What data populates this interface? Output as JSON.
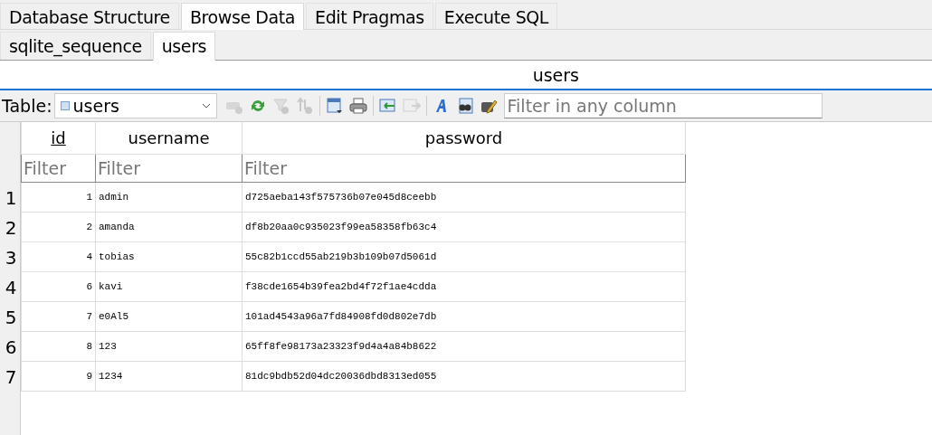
{
  "tabs": [
    {
      "label": "Database Structure",
      "selected": false
    },
    {
      "label": "Browse Data",
      "selected": true
    },
    {
      "label": "Edit Pragmas",
      "selected": false
    },
    {
      "label": "Execute SQL",
      "selected": false
    }
  ],
  "table_tabs": [
    {
      "label": "sqlite_sequence",
      "selected": false
    },
    {
      "label": "users",
      "selected": true
    }
  ],
  "view_title": "users",
  "toolbar": {
    "table_label": "Table:",
    "table_value": "users",
    "button_groups": [
      [
        {
          "kind": "new-record",
          "disabled": true
        },
        {
          "kind": "refresh",
          "disabled": false
        },
        {
          "kind": "clear-filters",
          "disabled": true
        },
        {
          "kind": "clear-sort",
          "disabled": true
        }
      ],
      [
        {
          "kind": "save",
          "disabled": false
        },
        {
          "kind": "print",
          "disabled": false
        }
      ],
      [
        {
          "kind": "insert",
          "disabled": false
        },
        {
          "kind": "export",
          "disabled": true
        }
      ],
      [
        {
          "kind": "font",
          "disabled": false
        },
        {
          "kind": "find",
          "disabled": false
        },
        {
          "kind": "edit",
          "disabled": false
        }
      ]
    ],
    "filter_placeholder": "Filter in any column"
  },
  "table": {
    "columns": [
      {
        "label": "id",
        "key": true
      },
      {
        "label": "username",
        "key": false
      },
      {
        "label": "password",
        "key": false
      }
    ],
    "filters": [
      {
        "placeholder": "Filter"
      },
      {
        "placeholder": "Filter"
      },
      {
        "placeholder": "Filter"
      }
    ],
    "rows": [
      {
        "num": "1",
        "cells": [
          "1",
          "admin",
          "d725aeba143f575736b07e045d8ceebb"
        ]
      },
      {
        "num": "2",
        "cells": [
          "2",
          "amanda",
          "df8b20aa0c935023f99ea58358fb63c4"
        ]
      },
      {
        "num": "3",
        "cells": [
          "4",
          "tobias",
          "55c82b1ccd55ab219b3b109b07d5061d"
        ]
      },
      {
        "num": "4",
        "cells": [
          "6",
          "kavi",
          "f38cde1654b39fea2bd4f72f1ae4cdda"
        ]
      },
      {
        "num": "5",
        "cells": [
          "7",
          "e0Al5",
          "101ad4543a96a7fd84908fd0d802e7db"
        ]
      },
      {
        "num": "6",
        "cells": [
          "8",
          "123",
          "65ff8fe98173a23323f9d4a4a84b8622"
        ]
      },
      {
        "num": "7",
        "cells": [
          "9",
          "1234",
          "81dc9bdb52d04dc20036dbd8313ed055"
        ]
      }
    ]
  }
}
